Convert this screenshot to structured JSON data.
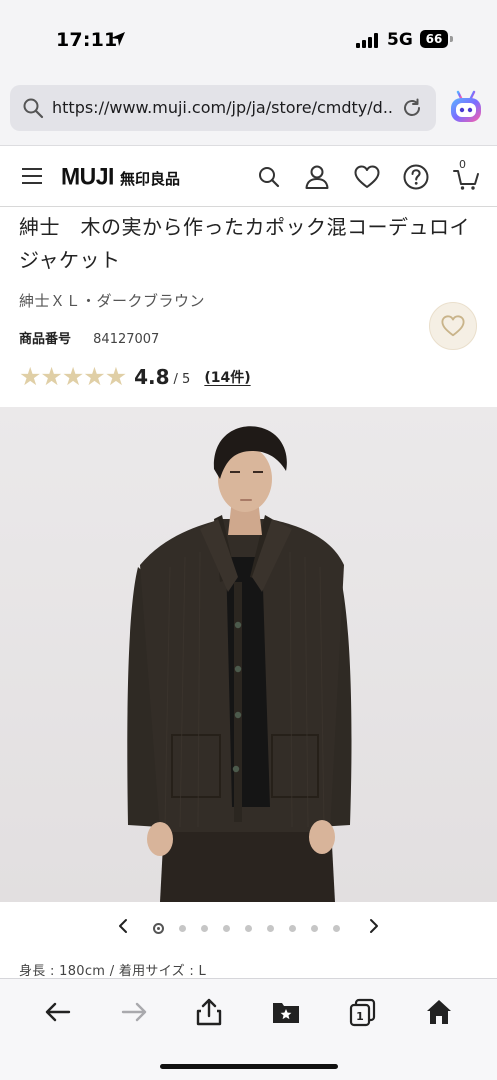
{
  "status_bar": {
    "time": "17:11",
    "network": "5G",
    "battery": "66"
  },
  "browser": {
    "url": "https://www.muji.com/jp/ja/store/cmdty/d..."
  },
  "header": {
    "logo_en": "MUJI",
    "logo_jp": "無印良品",
    "cart_count": "0"
  },
  "product": {
    "title": "紳士　木の実から作ったカポック混コーデュロイジャケット",
    "variant": "紳士ＸＬ・ダークブラウン",
    "sku_label": "商品番号",
    "sku_value": "84127007",
    "rating": {
      "value": "4.8",
      "max": "/ 5",
      "stars_filled": 5,
      "review_count": "(14件)"
    }
  },
  "carousel": {
    "total": 9,
    "active_index": 0
  },
  "model_info": "身長 : 180cm / 着用サイズ : L",
  "colors": {
    "star": "#e0cfa6",
    "fav_bg": "#f5efe4",
    "jacket": "#2f2a24"
  }
}
